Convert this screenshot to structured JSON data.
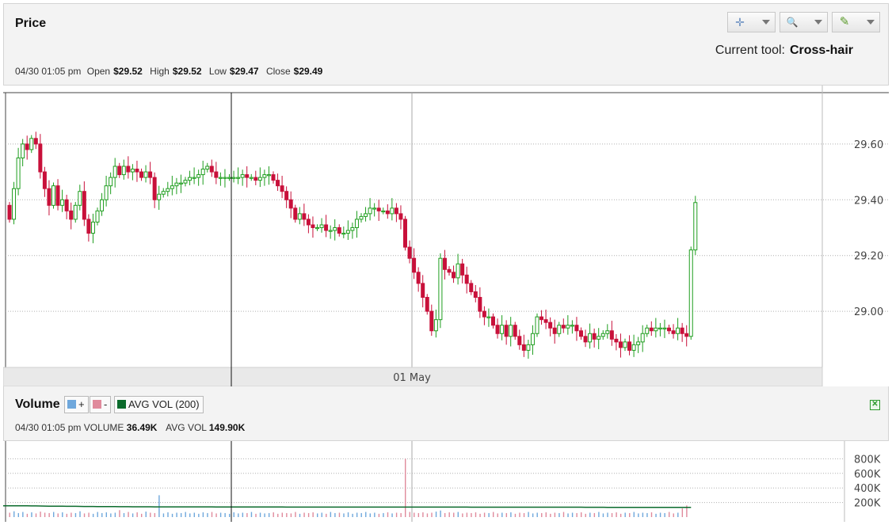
{
  "price_panel": {
    "title": "Price",
    "ohlc": {
      "datetime": "04/30 01:05 pm",
      "open_label": "Open",
      "open": "$29.52",
      "high_label": "High",
      "high": "$29.52",
      "low_label": "Low",
      "low": "$29.47",
      "close_label": "Close",
      "close": "$29.49"
    },
    "current_tool_label": "Current tool:",
    "current_tool": "Cross-hair",
    "tools": [
      {
        "icon": "crosshair-icon",
        "glyph": "✛"
      },
      {
        "icon": "zoom-icon",
        "glyph": "🔍"
      },
      {
        "icon": "pencil-icon",
        "glyph": "✎"
      }
    ]
  },
  "volume_panel": {
    "title": "Volume",
    "plus_label": "+",
    "minus_label": "-",
    "avg_label": "AVG VOL (200)",
    "info": {
      "datetime": "04/30 01:05 pm",
      "volume_label": "VOLUME",
      "volume": "36.49K",
      "avg_label": "AVG VOL",
      "avg": "149.90K"
    },
    "close_glyph": "✕"
  },
  "colors": {
    "up": "#1e9e1e",
    "down": "#c8103a",
    "vol_up": "#6fa8dc",
    "vol_down": "#e08a9c",
    "avg_line": "#0b6b2c"
  },
  "chart_data": {
    "type": "candlestick",
    "x_label": "01 May",
    "y_ticks": [
      "29.60",
      "29.40",
      "29.20",
      "29.00"
    ],
    "ylim": [
      28.81,
      29.77
    ],
    "grid": true,
    "closes": [
      29.33,
      29.44,
      29.55,
      29.6,
      29.58,
      29.62,
      29.6,
      29.5,
      29.44,
      29.38,
      29.45,
      29.38,
      29.4,
      29.36,
      29.33,
      29.38,
      29.43,
      29.33,
      29.28,
      29.32,
      29.36,
      29.4,
      29.45,
      29.48,
      29.52,
      29.49,
      29.52,
      29.5,
      29.51,
      29.5,
      29.48,
      29.5,
      29.48,
      29.4,
      29.42,
      29.43,
      29.44,
      29.45,
      29.46,
      29.46,
      29.47,
      29.48,
      29.48,
      29.49,
      29.51,
      29.52,
      29.5,
      29.48,
      29.48,
      29.48,
      29.48,
      29.48,
      29.48,
      29.49,
      29.48,
      29.48,
      29.47,
      29.48,
      29.49,
      29.49,
      29.47,
      29.45,
      29.43,
      29.4,
      29.37,
      29.33,
      29.35,
      29.33,
      29.31,
      29.3,
      29.3,
      29.31,
      29.29,
      29.29,
      29.3,
      29.28,
      29.28,
      29.29,
      29.3,
      29.33,
      29.34,
      29.35,
      29.37,
      29.37,
      29.36,
      29.36,
      29.35,
      29.37,
      29.35,
      29.33,
      29.23,
      29.19,
      29.14,
      29.1,
      29.05,
      29.0,
      28.93,
      28.97,
      29.19,
      29.15,
      29.14,
      29.12,
      29.17,
      29.13,
      29.1,
      29.07,
      29.05,
      29.0,
      28.98,
      28.98,
      28.95,
      28.92,
      28.95,
      28.91,
      28.95,
      28.91,
      28.88,
      28.86,
      28.88,
      28.92,
      28.98,
      28.97,
      28.96,
      28.94,
      28.92,
      28.95,
      28.94,
      28.95,
      28.95,
      28.93,
      28.91,
      28.89,
      28.92,
      28.9,
      28.91,
      28.92,
      28.93,
      28.9,
      28.89,
      28.87,
      28.89,
      28.86,
      28.88,
      28.89,
      28.92,
      28.94,
      28.93,
      28.94,
      28.94,
      28.94,
      28.93,
      28.92,
      28.94,
      28.92,
      28.91,
      29.22,
      29.39
    ],
    "volumes": [
      60,
      80,
      55,
      70,
      45,
      65,
      50,
      75,
      60,
      55,
      70,
      50,
      65,
      45,
      60,
      55,
      80,
      50,
      60,
      45,
      70,
      55,
      65,
      50,
      60,
      95,
      55,
      70,
      50,
      65,
      45,
      75,
      60,
      55,
      300,
      50,
      65,
      45,
      60,
      55,
      70,
      50,
      60,
      45,
      65,
      55,
      70,
      50,
      60,
      55,
      45,
      65,
      50,
      60,
      55,
      70,
      45,
      60,
      50,
      55,
      65,
      45,
      60,
      55,
      50,
      70,
      45,
      60,
      55,
      65,
      50,
      60,
      45,
      70,
      55,
      60,
      50,
      65,
      45,
      60,
      55,
      70,
      50,
      60,
      45,
      55,
      65,
      50,
      60,
      55,
      800,
      70,
      60,
      55,
      65,
      50,
      60,
      75,
      90,
      55,
      65,
      60,
      70,
      50,
      60,
      55,
      65,
      45,
      60,
      55,
      70,
      50,
      60,
      55,
      65,
      45,
      60,
      55,
      70,
      50,
      60,
      55,
      65,
      45,
      60,
      55,
      70,
      50,
      60,
      55,
      65,
      45,
      60,
      55,
      70,
      50,
      60,
      55,
      65,
      45,
      60,
      55,
      70,
      50,
      60,
      55,
      65,
      45,
      60,
      55,
      70,
      50,
      60,
      120,
      160
    ],
    "avg_vol": [
      155,
      155,
      155,
      154,
      154,
      153,
      153,
      152,
      151,
      150,
      150,
      150,
      149,
      148,
      148,
      148,
      147,
      146,
      146,
      146,
      145,
      145,
      145,
      144,
      143,
      142,
      142,
      142,
      141,
      141,
      141,
      141,
      141,
      140,
      140,
      140,
      140,
      140,
      140,
      140,
      140,
      140,
      140,
      140,
      140,
      140,
      140,
      139,
      139,
      139,
      139,
      139,
      139,
      138,
      138,
      138,
      138,
      138,
      138,
      138,
      138,
      138,
      138,
      137,
      137,
      137,
      137,
      137,
      137,
      137,
      137,
      137,
      137,
      137,
      137,
      137,
      137,
      137,
      137,
      137,
      137,
      137,
      137,
      137,
      137,
      137,
      137,
      137,
      137,
      137,
      137,
      137,
      137,
      137,
      137,
      137,
      137,
      137,
      137,
      137,
      137,
      137,
      137,
      137,
      137,
      136,
      136,
      136,
      136,
      136,
      136,
      136,
      136,
      136,
      136,
      136,
      136,
      136,
      136,
      136,
      136,
      136,
      136,
      136,
      136,
      136,
      136,
      136,
      136,
      136,
      136,
      135,
      135,
      135,
      135,
      135,
      134,
      134,
      134,
      134,
      134,
      134,
      133,
      133,
      133,
      133,
      133,
      133,
      133,
      133,
      133,
      133,
      133,
      133,
      133,
      133
    ],
    "volume_y_ticks": [
      "800K",
      "600K",
      "400K",
      "200K"
    ],
    "volume_ylim": [
      0,
      1000
    ]
  }
}
